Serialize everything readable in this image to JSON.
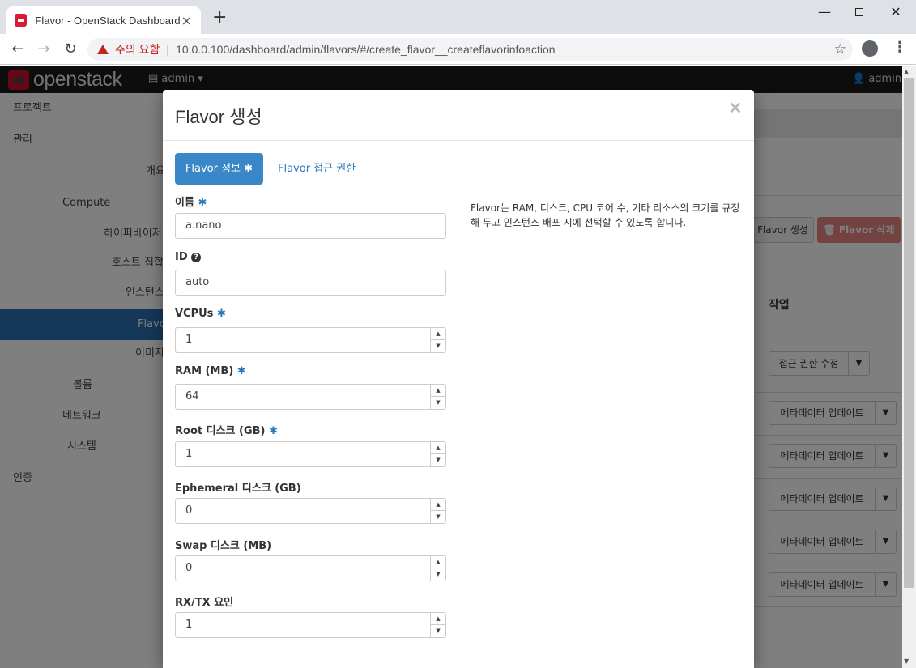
{
  "browser": {
    "tab_title": "Flavor - OpenStack Dashboard",
    "tab_close": "×",
    "new_tab": "+",
    "security_warning": "주의 요함",
    "url": "10.0.0.100/dashboard/admin/flavors/#/create_flavor__createflavorinfoaction"
  },
  "header": {
    "logo_text": "openstack",
    "project_menu": "admin ▾",
    "user_menu": "admin ▾"
  },
  "sidebar": {
    "items": [
      "프로젝트",
      "관리",
      "개요",
      "Compute",
      "하이퍼바이저",
      "호스트 집합",
      "인스턴스",
      "Flavor",
      "이미지",
      "볼륨",
      "네트워크",
      "시스템",
      "인증"
    ]
  },
  "background": {
    "create_button": "Flavor 생성",
    "delete_button": "Flavor 삭제",
    "column_actions": "작업",
    "row_buttons": [
      "접근 권한 수정",
      "메타데이터 업데이트",
      "메타데이터 업데이트",
      "메타데이터 업데이트",
      "메타데이터 업데이트",
      "메타데이터 업데이트"
    ]
  },
  "modal": {
    "title": "Flavor 생성",
    "close": "×",
    "tabs": [
      {
        "label": "Flavor 정보",
        "required": true,
        "active": true
      },
      {
        "label": "Flavor 접근 권한",
        "required": false,
        "active": false
      }
    ],
    "required_marker": "✱",
    "fields": [
      {
        "label": "이름",
        "required": true,
        "value": "a.nano",
        "spinner": false
      },
      {
        "label": "ID",
        "required": false,
        "value": "auto",
        "spinner": false,
        "help_icon": true
      },
      {
        "label": "VCPUs",
        "required": true,
        "value": "1",
        "spinner": true
      },
      {
        "label": "RAM (MB)",
        "required": true,
        "value": "64",
        "spinner": true
      },
      {
        "label": "Root 디스크 (GB)",
        "required": true,
        "value": "1",
        "spinner": true
      },
      {
        "label": "Ephemeral 디스크 (GB)",
        "required": false,
        "value": "0",
        "spinner": true
      },
      {
        "label": "Swap 디스크 (MB)",
        "required": false,
        "value": "0",
        "spinner": true
      },
      {
        "label": "RX/TX 요인",
        "required": false,
        "value": "1",
        "spinner": true
      }
    ],
    "help_text": "Flavor는 RAM, 디스크, CPU 코어 수, 기타 리소스의 크기를 규정해 두고 인스턴스 배포 시에 선택할 수 있도록 합니다."
  },
  "colors": {
    "primary": "#3a87c7",
    "link": "#2a7bc0",
    "danger": "#d9534f",
    "header_bg": "#1b1b1b",
    "sidebar_active": "#2a6fb0"
  }
}
